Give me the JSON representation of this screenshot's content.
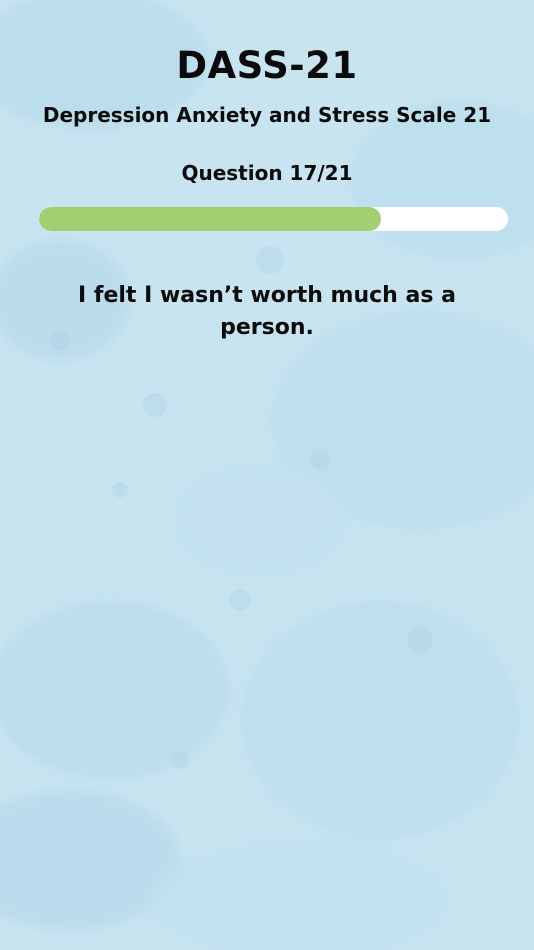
{
  "header": {
    "title": "DASS-21",
    "subtitle": "Depression Anxiety and Stress Scale 21",
    "question_counter": "Question 17/21"
  },
  "progress": {
    "current": 17,
    "total": 21,
    "fraction": 0.73,
    "fill_color": "#a3cf72",
    "track_color": "#ffffff"
  },
  "question": {
    "text": "I felt I wasn’t worth much as a person."
  },
  "background": {
    "base_color": "#c8e4f0",
    "stain_color": "#b3d8ea"
  }
}
